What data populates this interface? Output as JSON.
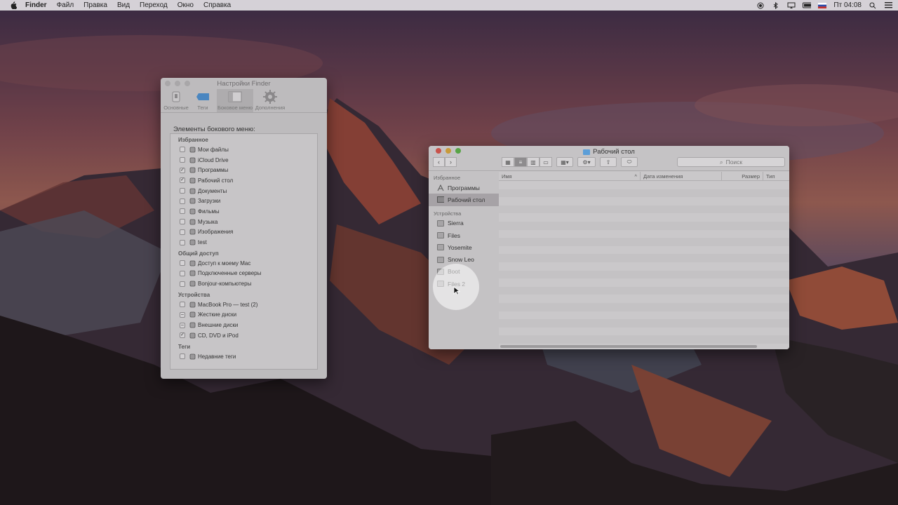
{
  "menubar": {
    "app_name": "Finder",
    "items": [
      "Файл",
      "Правка",
      "Вид",
      "Переход",
      "Окно",
      "Справка"
    ],
    "clock": "Пт 04:08"
  },
  "prefs_window": {
    "title": "Настройки Finder",
    "tabs": [
      {
        "label": "Основные",
        "icon": "switch-icon"
      },
      {
        "label": "Теги",
        "icon": "tag-icon"
      },
      {
        "label": "Боковое меню",
        "icon": "sidebar-icon",
        "active": true
      },
      {
        "label": "Дополнения",
        "icon": "gear-icon"
      }
    ],
    "heading": "Элементы бокового меню:",
    "groups": [
      {
        "label": "Избранное",
        "items": [
          {
            "label": "Мои файлы",
            "checked": false,
            "icon": "all-files-icon"
          },
          {
            "label": "iCloud Drive",
            "checked": false,
            "icon": "cloud-icon"
          },
          {
            "label": "Программы",
            "checked": true,
            "icon": "applications-icon"
          },
          {
            "label": "Рабочий стол",
            "checked": true,
            "icon": "desktop-icon"
          },
          {
            "label": "Документы",
            "checked": false,
            "icon": "documents-icon"
          },
          {
            "label": "Загрузки",
            "checked": false,
            "icon": "downloads-icon"
          },
          {
            "label": "Фильмы",
            "checked": false,
            "icon": "movies-icon"
          },
          {
            "label": "Музыка",
            "checked": false,
            "icon": "music-icon"
          },
          {
            "label": "Изображения",
            "checked": false,
            "icon": "pictures-icon"
          },
          {
            "label": "test",
            "checked": false,
            "icon": "home-icon"
          }
        ]
      },
      {
        "label": "Общий доступ",
        "items": [
          {
            "label": "Доступ к моему Mac",
            "checked": false,
            "icon": "cloud-icon"
          },
          {
            "label": "Подключенные серверы",
            "checked": false,
            "icon": "server-icon"
          },
          {
            "label": "Bonjour-компьютеры",
            "checked": false,
            "icon": "bonjour-icon"
          }
        ]
      },
      {
        "label": "Устройства",
        "items": [
          {
            "label": "MacBook Pro — test (2)",
            "checked": false,
            "icon": "laptop-icon"
          },
          {
            "label": "Жесткие диски",
            "checked": "mixed",
            "icon": "hard-disk-icon"
          },
          {
            "label": "Внешние диски",
            "checked": "mixed",
            "icon": "external-disk-icon"
          },
          {
            "label": "CD, DVD и iPod",
            "checked": true,
            "icon": "cd-icon"
          }
        ]
      },
      {
        "label": "Теги",
        "items": [
          {
            "label": "Недавние теги",
            "checked": false,
            "icon": "tag-outline-icon"
          }
        ]
      }
    ]
  },
  "finder_window": {
    "title": "Рабочий стол",
    "search_placeholder": "Поиск",
    "sidebar": {
      "favorites_heading": "Избранное",
      "favorites": [
        {
          "label": "Программы",
          "icon": "applications-icon",
          "selected": false
        },
        {
          "label": "Рабочий стол",
          "icon": "desktop-icon",
          "selected": true
        }
      ],
      "devices_heading": "Устройства",
      "devices": [
        {
          "label": "Sierra",
          "icon": "disk-icon"
        },
        {
          "label": "Files",
          "icon": "disk-icon"
        },
        {
          "label": "Yosemite",
          "icon": "disk-icon"
        },
        {
          "label": "Snow Leo",
          "icon": "disk-icon"
        },
        {
          "label": "Boot",
          "icon": "disk-icon"
        },
        {
          "label": "Files 2",
          "icon": "disk-icon"
        }
      ]
    },
    "columns": [
      "Имя",
      "Дата изменения",
      "Размер",
      "Тип"
    ]
  },
  "colors": {
    "close": "#c8524a",
    "minimize": "#c89a3a",
    "zoom": "#58a446",
    "folder": "#5c9ed8"
  }
}
